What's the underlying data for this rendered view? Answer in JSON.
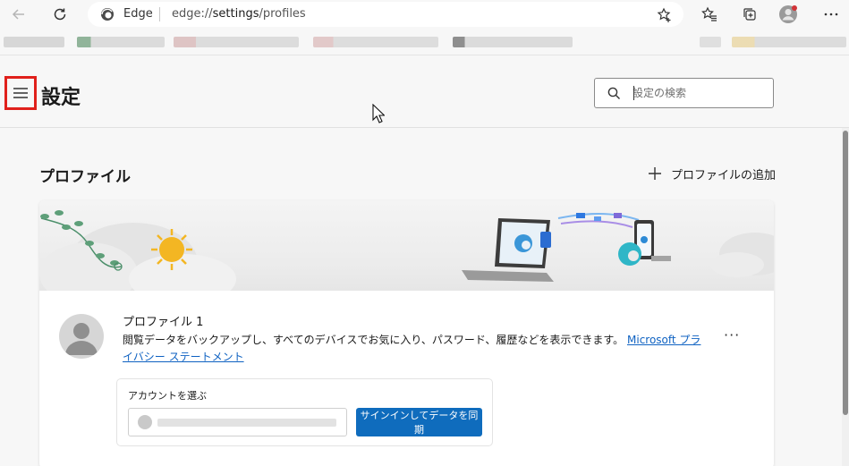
{
  "browser": {
    "brand": "Edge",
    "url_prefix": "edge://",
    "url_path": "settings",
    "url_suffix": "/profiles"
  },
  "settings": {
    "title": "設定",
    "search_placeholder": "設定の検索"
  },
  "profiles": {
    "section_title": "プロファイル",
    "add_profile_label": "プロファイルの追加",
    "profile_name": "プロファイル 1",
    "description": "閲覧データをバックアップし、すべてのデバイスでお気に入り、パスワード、履歴などを表示できます。",
    "privacy_link": "Microsoft プライバシー ステートメント",
    "more_label": "···",
    "account_label": "アカウントを選ぶ",
    "signin_button": "サインインしてデータを同期"
  },
  "colors": {
    "accent": "#0f6cbd",
    "link": "#0f62c2",
    "highlight": "#e0201b"
  }
}
